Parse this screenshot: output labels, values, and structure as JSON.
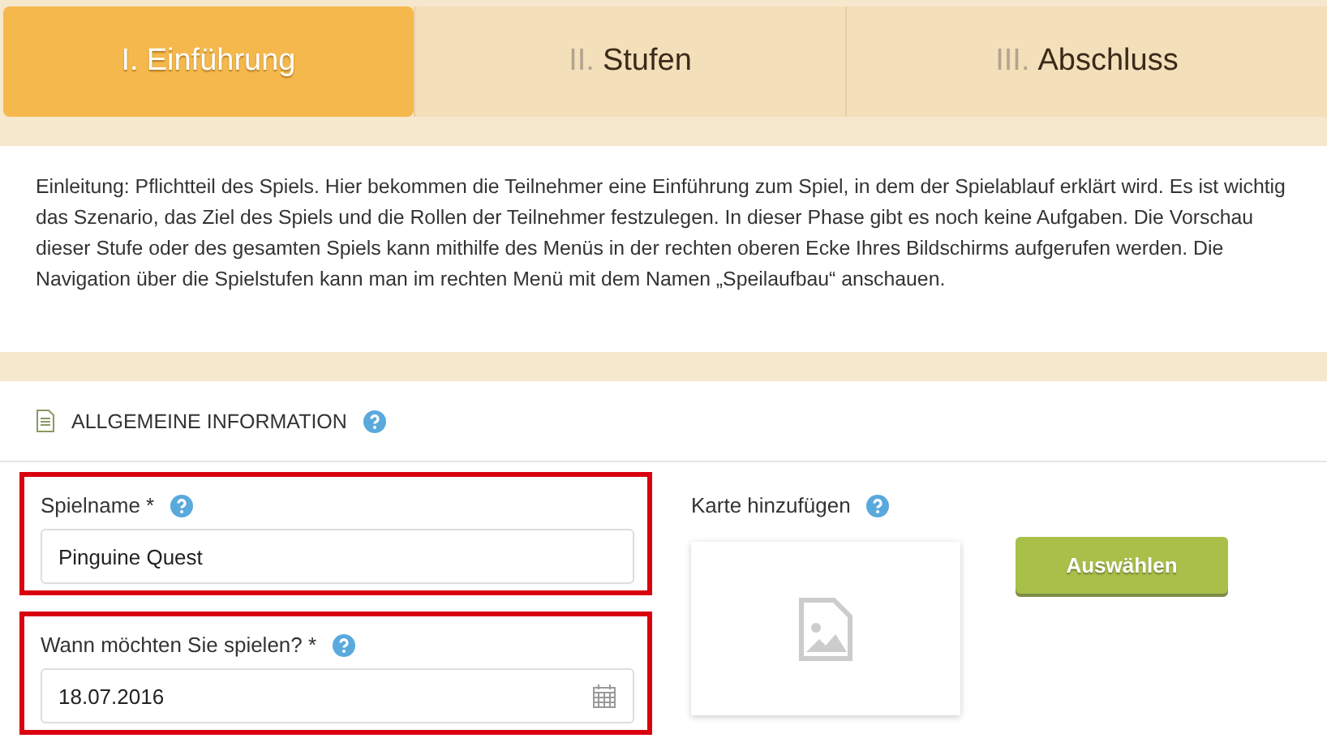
{
  "tabs": [
    {
      "numeral": "I.",
      "label": "Einführung",
      "selected": true
    },
    {
      "numeral": "II.",
      "label": "Stufen",
      "selected": false
    },
    {
      "numeral": "III.",
      "label": "Abschluss",
      "selected": false
    }
  ],
  "description": "Einleitung: Pflichtteil des Spiels. Hier bekommen die Teilnehmer eine Einführung zum Spiel, in dem der Spielablauf erklärt wird. Es ist wichtig das Szenario, das Ziel des Spiels und die Rollen der Teilnehmer festzulegen. In dieser Phase gibt es noch keine Aufgaben. Die Vorschau dieser Stufe oder des gesamten Spiels kann mithilfe des Menüs in der rechten oberen Ecke Ihres Bildschirms aufgerufen werden. Die Navigation über die Spielstufen kann man im rechten Menü mit dem Namen „Speilaufbau“ anschauen.",
  "section": {
    "title": "ALLGEMEINE INFORMATION"
  },
  "fields": [
    {
      "kind": "text",
      "label": "Spielname *",
      "value": "Pinguine Quest",
      "highlighted": true
    },
    {
      "kind": "date",
      "label": "Wann möchten Sie spielen? *",
      "value": "18.07.2016",
      "highlighted": true
    }
  ],
  "map": {
    "label": "Karte hinzufügen",
    "button": "Auswählen"
  }
}
